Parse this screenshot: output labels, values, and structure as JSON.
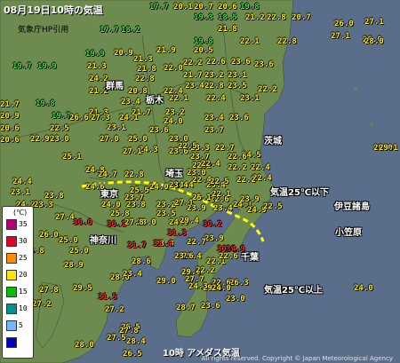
{
  "header": {
    "title": "08月19日10時の気温",
    "subtitle": "気象庁HP引用"
  },
  "footer": {
    "caption": "10時 アメダス気温",
    "credit": "All rights reserved. Copyright © Japan Meteorological Agency"
  },
  "prefectures": [
    "群馬",
    "栃木",
    "茨城",
    "埼玉",
    "東京",
    "千葉",
    "神奈川",
    "伊豆諸島",
    "小笠原"
  ],
  "annotations": {
    "below25": "気温25℃以下",
    "above25": "気温25℃以上"
  },
  "legend": {
    "unit": "(℃)",
    "levels": [
      {
        "label": "35",
        "color": "#b4007a"
      },
      {
        "label": "30",
        "color": "#e0002a"
      },
      {
        "label": "25",
        "color": "#ff8c00"
      },
      {
        "label": "20",
        "color": "#ffe600"
      },
      {
        "label": "15",
        "color": "#00c000"
      },
      {
        "label": "10",
        "color": "#009090"
      },
      {
        "label": "5",
        "color": "#78b4ff"
      },
      {
        "label": "",
        "color": "#0000c0"
      }
    ]
  },
  "colors": {
    "sea": "#5a6e8c",
    "land": "#6d8a4f",
    "boundary_line": "#ffff00"
  },
  "temperatures": [
    {
      "v": "17.7",
      "c": "green"
    },
    {
      "v": "20.1",
      "c": "yellow"
    },
    {
      "v": "20.7",
      "c": "yellow"
    },
    {
      "v": "20.6",
      "c": "yellow"
    },
    {
      "v": "19.8",
      "c": "green"
    },
    {
      "v": "19.3",
      "c": "green"
    },
    {
      "v": "18.5",
      "c": "green"
    },
    {
      "v": "21.2",
      "c": "yellow"
    },
    {
      "v": "22.8",
      "c": "yellow"
    },
    {
      "v": "20.7",
      "c": "yellow"
    },
    {
      "v": "21.8",
      "c": "yellow"
    },
    {
      "v": "17.7",
      "c": "green"
    },
    {
      "v": "18.2",
      "c": "green"
    },
    {
      "v": "19.8",
      "c": "green"
    },
    {
      "v": "22.1",
      "c": "yellow"
    },
    {
      "v": "22.8",
      "c": "yellow"
    },
    {
      "v": "19.9",
      "c": "green"
    },
    {
      "v": "20.9",
      "c": "yellow"
    },
    {
      "v": "21.9",
      "c": "yellow"
    },
    {
      "v": "20.5",
      "c": "yellow"
    },
    {
      "v": "21.3",
      "c": "yellow"
    },
    {
      "v": "22.2",
      "c": "yellow"
    },
    {
      "v": "22.6",
      "c": "yellow"
    },
    {
      "v": "23.6",
      "c": "yellow"
    },
    {
      "v": "23.6",
      "c": "yellow"
    },
    {
      "v": "19.7",
      "c": "green"
    },
    {
      "v": "19.9",
      "c": "green"
    },
    {
      "v": "21.3",
      "c": "yellow"
    },
    {
      "v": "21.8",
      "c": "yellow"
    },
    {
      "v": "22.0",
      "c": "yellow"
    },
    {
      "v": "21.7",
      "c": "yellow"
    },
    {
      "v": "23.2",
      "c": "yellow"
    },
    {
      "v": "23.1",
      "c": "yellow"
    },
    {
      "v": "24.2",
      "c": "yellow"
    },
    {
      "v": "22.8",
      "c": "yellow"
    },
    {
      "v": "23.4",
      "c": "yellow"
    },
    {
      "v": "21.2",
      "c": "yellow"
    },
    {
      "v": "20.8",
      "c": "yellow"
    },
    {
      "v": "22.4",
      "c": "yellow"
    },
    {
      "v": "22.8",
      "c": "yellow"
    },
    {
      "v": "23.5",
      "c": "yellow"
    },
    {
      "v": "22.2",
      "c": "yellow"
    },
    {
      "v": "23.4",
      "c": "yellow"
    },
    {
      "v": "22.1",
      "c": "yellow"
    },
    {
      "v": "22.4",
      "c": "yellow"
    },
    {
      "v": "23.1",
      "c": "yellow"
    },
    {
      "v": "21.7",
      "c": "yellow"
    },
    {
      "v": "19.8",
      "c": "green"
    },
    {
      "v": "19.7",
      "c": "green"
    },
    {
      "v": "21.3",
      "c": "yellow"
    },
    {
      "v": "21.7",
      "c": "yellow"
    },
    {
      "v": "23.2",
      "c": "yellow"
    },
    {
      "v": "20.9",
      "c": "yellow"
    },
    {
      "v": "22.5",
      "c": "yellow"
    },
    {
      "v": "26.6",
      "c": "yellow"
    },
    {
      "v": "27.3",
      "c": "yellow"
    },
    {
      "v": "24.1",
      "c": "yellow"
    },
    {
      "v": "24.0",
      "c": "yellow"
    },
    {
      "v": "23.4",
      "c": "yellow"
    },
    {
      "v": "23.6",
      "c": "yellow"
    },
    {
      "v": "23.1",
      "c": "yellow"
    },
    {
      "v": "20.6",
      "c": "yellow"
    },
    {
      "v": "23.0",
      "c": "yellow"
    },
    {
      "v": "23.6",
      "c": "yellow"
    },
    {
      "v": "20.6",
      "c": "yellow"
    },
    {
      "v": "22.9",
      "c": "yellow"
    },
    {
      "v": "27.0",
      "c": "yellow"
    },
    {
      "v": "25.0",
      "c": "yellow"
    },
    {
      "v": "23.0",
      "c": "yellow"
    },
    {
      "v": "23.7",
      "c": "yellow"
    },
    {
      "v": "24.3",
      "c": "yellow"
    },
    {
      "v": "23.3",
      "c": "yellow"
    },
    {
      "v": "22.7",
      "c": "yellow"
    },
    {
      "v": "24.5",
      "c": "yellow"
    },
    {
      "v": "27.1",
      "c": "yellow"
    },
    {
      "v": "23.6",
      "c": "yellow"
    },
    {
      "v": "23.7",
      "c": "yellow"
    },
    {
      "v": "25.1",
      "c": "yellow"
    },
    {
      "v": "22.6",
      "c": "yellow"
    },
    {
      "v": "22.4",
      "c": "yellow"
    },
    {
      "v": "24.8",
      "c": "yellow"
    },
    {
      "v": "22.2",
      "c": "yellow"
    },
    {
      "v": "24.4",
      "c": "yellow"
    },
    {
      "v": "24.7",
      "c": "yellow"
    },
    {
      "v": "22.8",
      "c": "yellow"
    },
    {
      "v": "22.2",
      "c": "yellow"
    },
    {
      "v": "24.6",
      "c": "yellow"
    },
    {
      "v": "23.1",
      "c": "yellow"
    },
    {
      "v": "22.4",
      "c": "yellow"
    },
    {
      "v": "24.4",
      "c": "yellow"
    },
    {
      "v": "23.4",
      "c": "yellow"
    },
    {
      "v": "23.8",
      "c": "yellow"
    },
    {
      "v": "22.4",
      "c": "yellow"
    },
    {
      "v": "24.0",
      "c": "yellow"
    },
    {
      "v": "23.7",
      "c": "yellow"
    },
    {
      "v": "22.6",
      "c": "yellow"
    },
    {
      "v": "22.2",
      "c": "yellow"
    },
    {
      "v": "24.2",
      "c": "yellow"
    },
    {
      "v": "23.3",
      "c": "yellow"
    },
    {
      "v": "25.5",
      "c": "yellow"
    },
    {
      "v": "24.0",
      "c": "yellow"
    },
    {
      "v": "22.5",
      "c": "yellow"
    },
    {
      "v": "23.4",
      "c": "yellow"
    },
    {
      "v": "22.1",
      "c": "yellow"
    },
    {
      "v": "25.1",
      "c": "yellow"
    },
    {
      "v": "23.8",
      "c": "yellow"
    },
    {
      "v": "24.1",
      "c": "yellow"
    },
    {
      "v": "23.2",
      "c": "yellow"
    },
    {
      "v": "25.8",
      "c": "yellow"
    },
    {
      "v": "27.1",
      "c": "yellow"
    },
    {
      "v": "23.9",
      "c": "yellow"
    },
    {
      "v": "23.4",
      "c": "yellow"
    },
    {
      "v": "24.9",
      "c": "yellow"
    },
    {
      "v": "23.9",
      "c": "yellow"
    },
    {
      "v": "23.5",
      "c": "yellow"
    },
    {
      "v": "27.4",
      "c": "yellow"
    },
    {
      "v": "23.0",
      "c": "yellow"
    },
    {
      "v": "27.8",
      "c": "yellow"
    },
    {
      "v": "24.6",
      "c": "yellow"
    },
    {
      "v": "29.4",
      "c": "yellow"
    },
    {
      "v": "30.2",
      "c": "red"
    },
    {
      "v": "22.5",
      "c": "yellow"
    },
    {
      "v": "26.0",
      "c": "yellow"
    },
    {
      "v": "25.0",
      "c": "yellow"
    },
    {
      "v": "30.0",
      "c": "red"
    },
    {
      "v": "30.1",
      "c": "red"
    },
    {
      "v": "28.8",
      "c": "yellow"
    },
    {
      "v": "31.3",
      "c": "red"
    },
    {
      "v": "25.8",
      "c": "yellow"
    },
    {
      "v": "25.0",
      "c": "yellow"
    },
    {
      "v": "31.7",
      "c": "red"
    },
    {
      "v": "31.4",
      "c": "red"
    },
    {
      "v": "29.4",
      "c": "yellow"
    },
    {
      "v": "30.9",
      "c": "red"
    },
    {
      "v": "30.4",
      "c": "red"
    },
    {
      "v": "28.9",
      "c": "yellow"
    },
    {
      "v": "28.6",
      "c": "yellow"
    },
    {
      "v": "29.0",
      "c": "yellow"
    },
    {
      "v": "29.0",
      "c": "yellow"
    },
    {
      "v": "28.6",
      "c": "yellow"
    },
    {
      "v": "29.5",
      "c": "yellow"
    },
    {
      "v": "27.7",
      "c": "yellow"
    },
    {
      "v": "29.3",
      "c": "yellow"
    },
    {
      "v": "26.3",
      "c": "yellow"
    },
    {
      "v": "27.8",
      "c": "yellow"
    },
    {
      "v": "31.5",
      "c": "red"
    },
    {
      "v": "28.7",
      "c": "yellow"
    },
    {
      "v": "27.2",
      "c": "yellow"
    },
    {
      "v": "26.5",
      "c": "yellow"
    },
    {
      "v": "28.4",
      "c": "yellow"
    },
    {
      "v": "27.5",
      "c": "yellow"
    },
    {
      "v": "28.0",
      "c": "yellow"
    },
    {
      "v": "26.5",
      "c": "yellow"
    },
    {
      "v": "27.2",
      "c": "yellow"
    },
    {
      "v": "27.8",
      "c": "yellow"
    },
    {
      "v": "28.0",
      "c": "yellow"
    },
    {
      "v": "27.1",
      "c": "yellow"
    },
    {
      "v": "28.0",
      "c": "yellow"
    },
    {
      "v": "29.1",
      "c": "yellow"
    },
    {
      "v": "24.0",
      "c": "yellow"
    },
    {
      "v": "23.4",
      "c": "yellow"
    },
    {
      "v": "22.6",
      "c": "yellow"
    },
    {
      "v": "22.1",
      "c": "yellow"
    },
    {
      "v": "23.9",
      "c": "yellow"
    },
    {
      "v": "22.6",
      "c": "yellow"
    },
    {
      "v": "22.7",
      "c": "yellow"
    },
    {
      "v": "23.6",
      "c": "yellow"
    },
    {
      "v": "22.2",
      "c": "yellow"
    },
    {
      "v": "24.3",
      "c": "yellow"
    },
    {
      "v": "23.6",
      "c": "yellow"
    },
    {
      "v": "24.0",
      "c": "yellow"
    },
    {
      "v": "23.0",
      "c": "yellow"
    },
    {
      "v": "26.0",
      "c": "yellow"
    },
    {
      "v": "27.1",
      "c": "yellow"
    },
    {
      "v": "28.0",
      "c": "yellow"
    },
    {
      "v": "22.5",
      "c": "yellow"
    },
    {
      "v": "23.0",
      "c": "yellow"
    },
    {
      "v": "22.4",
      "c": "yellow"
    }
  ]
}
